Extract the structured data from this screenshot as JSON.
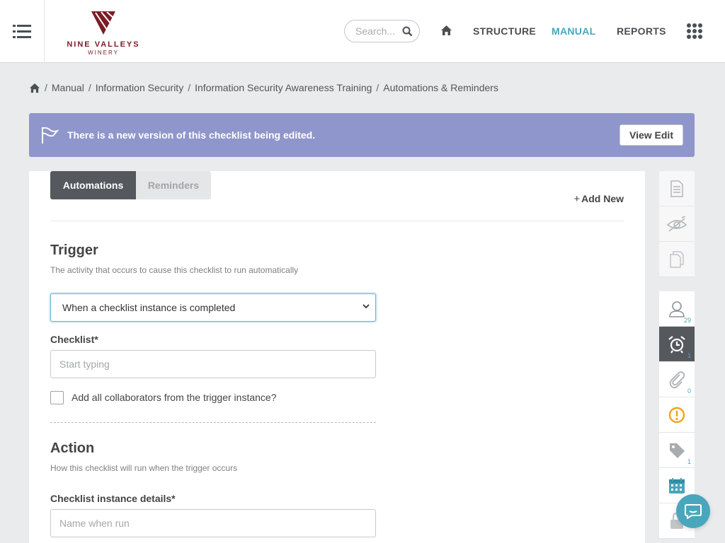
{
  "brand": {
    "name": "NINE VALLEYS",
    "sub": "WINERY",
    "color": "#7a1d27"
  },
  "header": {
    "search_placeholder": "Search...",
    "nav": {
      "structure": "STRUCTURE",
      "manual": "MANUAL",
      "reports": "REPORTS"
    },
    "active_color": "#47a6bb"
  },
  "breadcrumb": {
    "items": [
      "Manual",
      "Information Security",
      "Information Security Awareness Training",
      "Automations & Reminders"
    ]
  },
  "banner": {
    "message": "There is a new version of this checklist being edited.",
    "button": "View Edit",
    "color": "#8f96cb"
  },
  "tabs": [
    {
      "label": "Automations"
    },
    {
      "label": "Reminders"
    }
  ],
  "add_new": "Add New",
  "trigger": {
    "title": "Trigger",
    "description": "The activity that occurs to cause this checklist to run automatically",
    "selected": "When a checklist instance is completed",
    "checklist_label": "Checklist*",
    "checklist_placeholder": "Start typing",
    "collaborators_label": "Add all collaborators from the trigger instance?"
  },
  "action": {
    "title": "Action",
    "description": "How this checklist will run when the trigger occurs",
    "details_label": "Checklist instance details*",
    "details_placeholder": "Name when run"
  },
  "sidebar": {
    "counts": {
      "users": "29",
      "alarm": "1",
      "attachments": "0",
      "tags": "1"
    }
  }
}
